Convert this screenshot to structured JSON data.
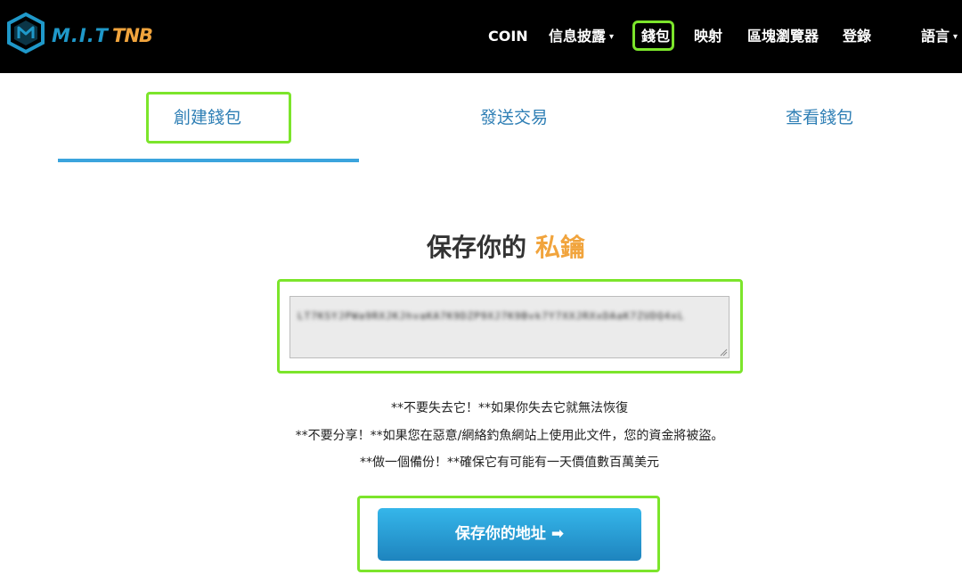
{
  "nav": {
    "logo_text": "M.I.T",
    "logo_suffix": "TNB",
    "items": [
      {
        "label": "COIN"
      },
      {
        "label": "信息披露",
        "caret": "▾"
      },
      {
        "label": "錢包"
      },
      {
        "label": "映射"
      },
      {
        "label": "區塊瀏覽器"
      },
      {
        "label": "登錄"
      },
      {
        "label": "語言",
        "caret": "▾"
      }
    ]
  },
  "tabs": [
    {
      "label": "創建錢包"
    },
    {
      "label": "發送交易"
    },
    {
      "label": "查看錢包"
    }
  ],
  "heading": {
    "prefix": "保存你的",
    "accent": "私鑰"
  },
  "private_key": {
    "value": "LT7KSYJPWa9RXJKJhvaKA7K9DZP9XJ7K9Bvk7Y7XXJRXxDAaK7ZUDQ4xL"
  },
  "warnings": [
    "**不要失去它！**如果你失去它就無法恢復",
    "**不要分享！**如果您在惡意/網絡釣魚網站上使用此文件，您的資金將被盜。",
    "**做一個備份！**確保它有可能有一天價值數百萬美元"
  ],
  "save_button": {
    "label": "保存你的地址",
    "arrow": "➡"
  },
  "colors": {
    "accent": "#f1a43d",
    "link": "#2f7fb5",
    "highlight": "#7ce52b",
    "button": "#2596cf"
  }
}
